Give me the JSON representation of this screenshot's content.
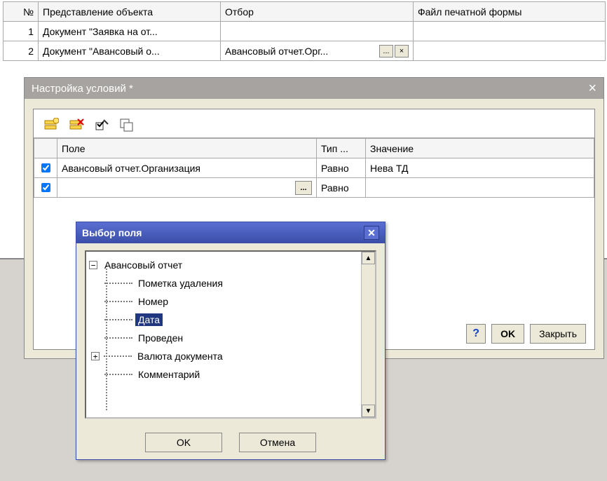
{
  "main_table": {
    "headers": {
      "num": "№",
      "obj": "Представление объекта",
      "sel": "Отбор",
      "file": "Файл печатной формы"
    },
    "rows": [
      {
        "num": "1",
        "obj": "Документ \"Заявка на от...",
        "sel": "",
        "file": ""
      },
      {
        "num": "2",
        "obj": "Документ \"Авансовый о...",
        "sel": "Авансовый отчет.Орг...",
        "file": ""
      }
    ],
    "row2_buttons": {
      "ellipsis": "...",
      "x": "×"
    }
  },
  "cond": {
    "title": "Настройка условий *",
    "close_x": "×",
    "toolbar": {
      "add": "add-icon",
      "del": "del-icon",
      "edit": "edit-icon",
      "copy": "copy-icon"
    },
    "headers": {
      "chk": "",
      "field": "Поле",
      "type": "Тип ...",
      "value": "Значение"
    },
    "rows": [
      {
        "checked": true,
        "field": "Авансовый отчет.Организация",
        "type": "Равно",
        "value": "Нева ТД"
      },
      {
        "checked": true,
        "field": "",
        "ellipsis": "...",
        "type": "Равно",
        "value": ""
      }
    ],
    "footer": {
      "help": "?",
      "ok": "OK",
      "close": "Закрыть"
    }
  },
  "fieldsel": {
    "title": "Выбор поля",
    "close_x": "✕",
    "tree": {
      "root": "Авансовый отчет",
      "root_exp": "−",
      "items": [
        {
          "label": "Пометка удаления",
          "exp": null,
          "selected": false
        },
        {
          "label": "Номер",
          "exp": null,
          "selected": false
        },
        {
          "label": "Дата",
          "exp": null,
          "selected": true
        },
        {
          "label": "Проведен",
          "exp": null,
          "selected": false
        },
        {
          "label": "Валюта документа",
          "exp": "+",
          "selected": false
        },
        {
          "label": "Комментарий",
          "exp": null,
          "selected": false
        }
      ],
      "scroll": {
        "up": "▲",
        "down": "▼"
      }
    },
    "footer": {
      "ok": "OK",
      "cancel": "Отмена"
    }
  }
}
